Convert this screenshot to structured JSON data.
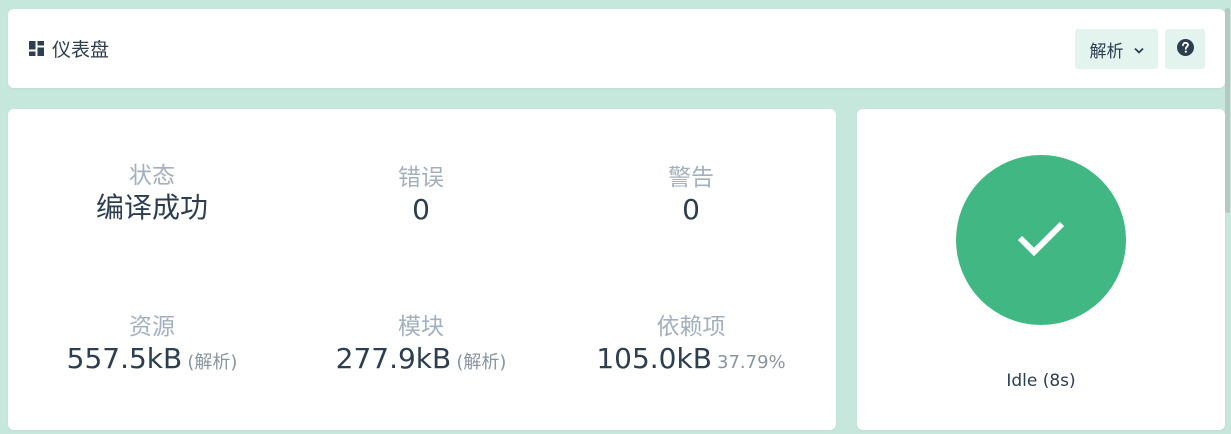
{
  "header": {
    "title": "仪表盘",
    "title_icon": "dashboard-icon",
    "mode_dropdown": {
      "label": "解析",
      "icon": "chevron-down-icon"
    },
    "help_button": {
      "icon": "question-circle-icon"
    }
  },
  "stats": {
    "status": {
      "label": "状态",
      "value": "编译成功"
    },
    "errors": {
      "label": "错误",
      "value": "0"
    },
    "warnings": {
      "label": "警告",
      "value": "0"
    },
    "assets": {
      "label": "资源",
      "value": "557.5kB",
      "sub": "(解析)"
    },
    "modules": {
      "label": "模块",
      "value": "277.9kB",
      "sub": "(解析)"
    },
    "dependencies": {
      "label": "依赖项",
      "value": "105.0kB",
      "sub": "37.79%"
    }
  },
  "status_card": {
    "icon": "check-icon",
    "text": "Idle (8s)"
  },
  "colors": {
    "background": "#c6e7dc",
    "accent": "#41b883",
    "button_bg": "#e3f4ee",
    "text": "#2c3e50",
    "muted": "#a3b0c0"
  }
}
